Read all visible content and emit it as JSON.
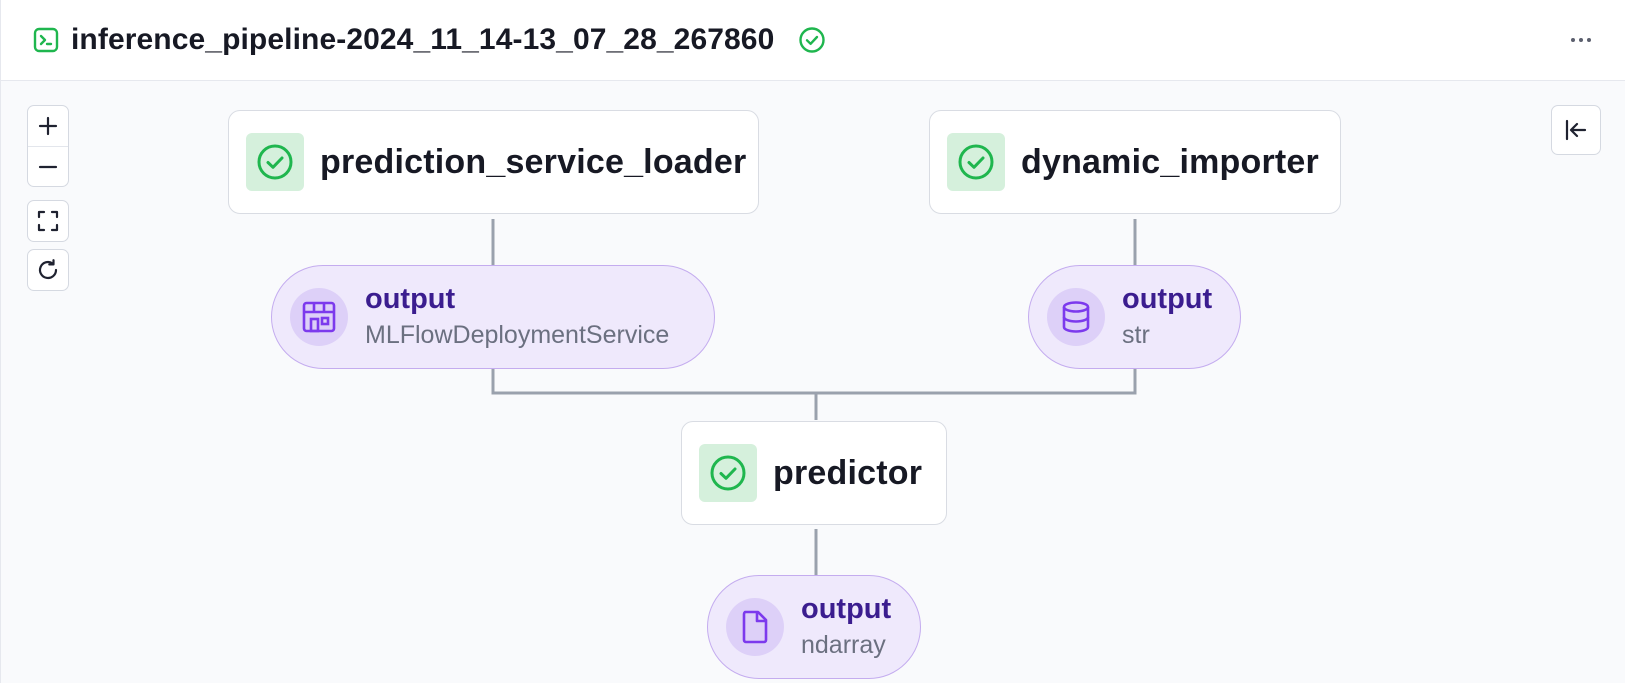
{
  "header": {
    "run_name": "inference_pipeline-2024_11_14-13_07_28_267860",
    "run_icon": "terminal-icon",
    "status_icon": "check-circle-icon",
    "menu_icon": "more-horizontal-icon"
  },
  "canvas_controls": {
    "zoom_in": "plus-icon",
    "zoom_out": "minus-icon",
    "fit_view": "fit-view-icon",
    "reset": "refresh-icon",
    "collapse_panel": "collapse-left-icon"
  },
  "steps": [
    {
      "name": "prediction_service_loader",
      "status": "completed"
    },
    {
      "name": "dynamic_importer",
      "status": "completed"
    },
    {
      "name": "predictor",
      "status": "completed"
    }
  ],
  "artifacts": [
    {
      "name": "output",
      "type": "MLFlowDeploymentService",
      "icon": "service-icon"
    },
    {
      "name": "output",
      "type": "str",
      "icon": "database-icon"
    },
    {
      "name": "output",
      "type": "ndarray",
      "icon": "file-icon"
    }
  ],
  "colors": {
    "success": "#1fb64e",
    "success_bg": "#d5f0dc",
    "artifact_bg": "#efe9fc",
    "artifact_border": "#c4acef",
    "artifact_accent": "#7c3aed",
    "edge": "#9aa1ad"
  }
}
